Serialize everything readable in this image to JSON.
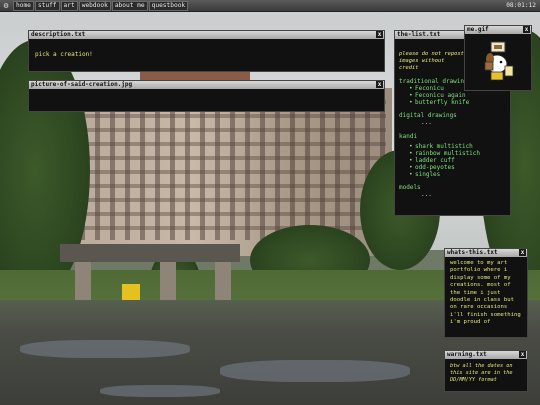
{
  "taskbar": {
    "buttons": [
      "home",
      "stuff",
      "art",
      "webdook",
      "about me",
      "questbook"
    ],
    "clock": "08:01:12"
  },
  "windows": {
    "description": {
      "title": "description.txt",
      "body": "pick a creation!"
    },
    "picture": {
      "title": "picture-of-said-creation.jpg"
    },
    "thelist": {
      "title": "the-list.txt",
      "intro": "please do not repost images without credit",
      "sections": [
        {
          "heading": "traditional drawings",
          "items": [
            "Feconicu",
            "Feconicu again",
            "butterfly knife"
          ]
        },
        {
          "heading": "digital drawings",
          "items": [],
          "more": "..."
        },
        {
          "heading": "kandi",
          "items": [
            "shark multistich",
            "rainbow multistich",
            "ladder cuff",
            "odd-peyotes",
            "singles"
          ]
        },
        {
          "heading": "models",
          "items": [],
          "more": "..."
        }
      ]
    },
    "me": {
      "title": "me.gif"
    },
    "whats": {
      "title": "whats-this.txt",
      "body": "welcome to my art portfolio where i display some of my creations. most of the time i just doodle in class but on rare occasions i'll finish something i'm proud of"
    },
    "warning": {
      "title": "warning.txt",
      "body": "btw all the dates on this site are in the DD/MM/YY format"
    }
  },
  "close_glyph": "x"
}
